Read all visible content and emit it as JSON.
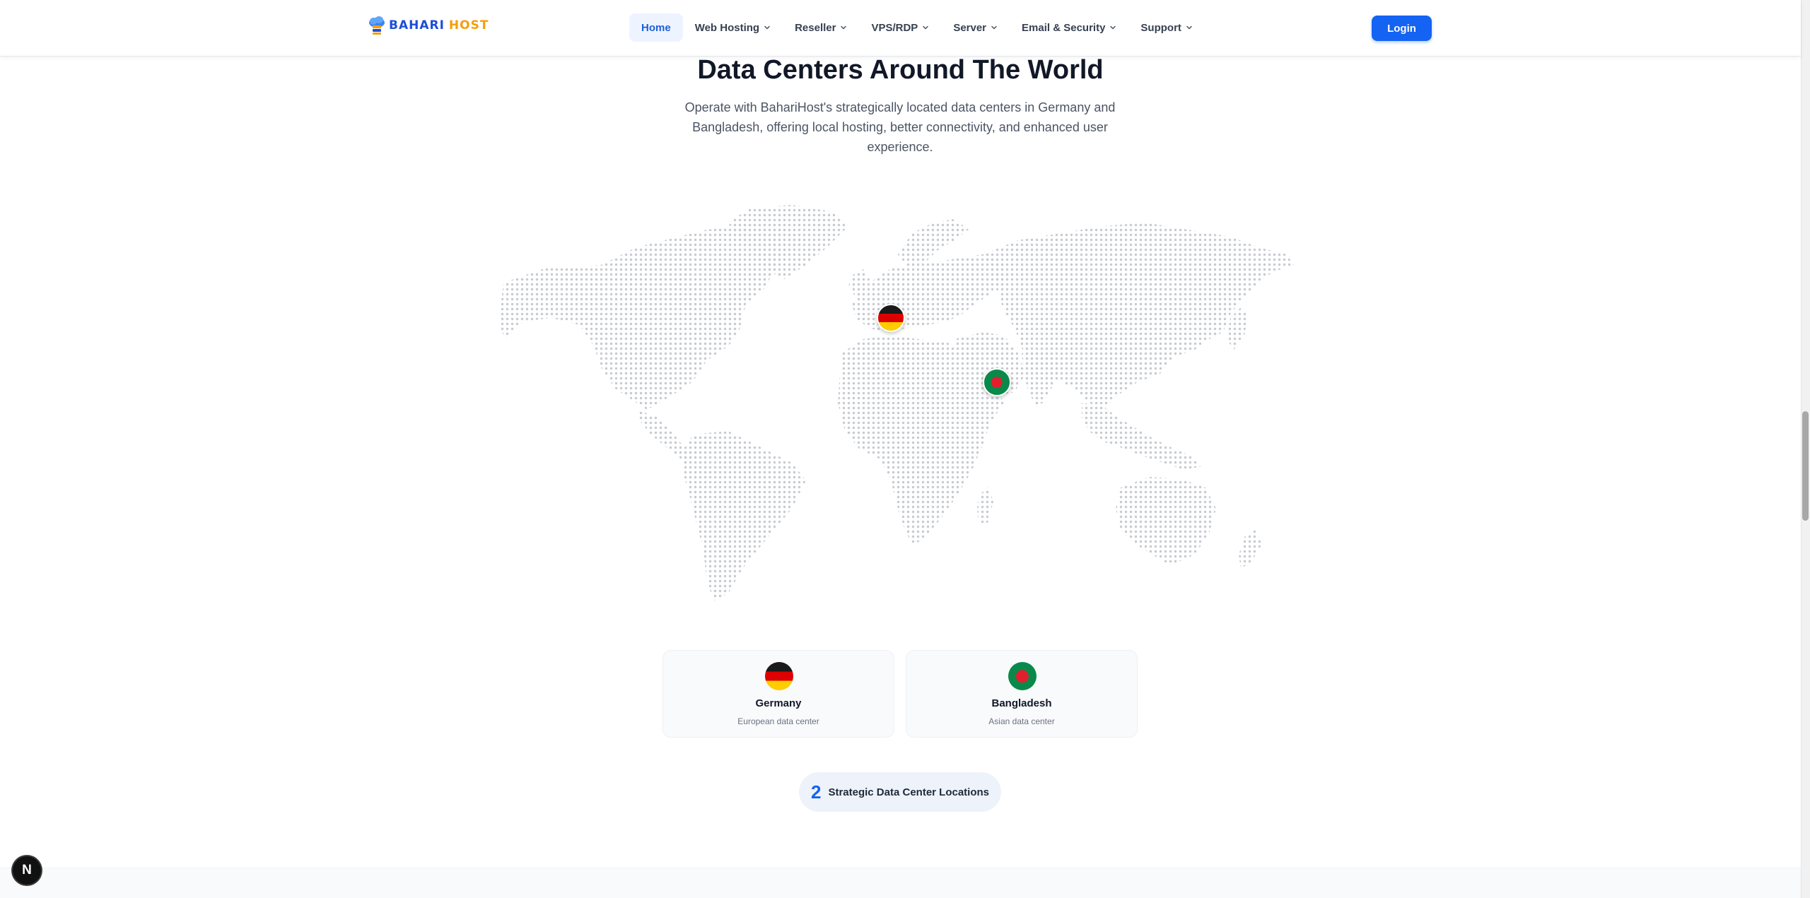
{
  "logo": {
    "brand_primary": "BAHARI",
    "brand_secondary": "HOST"
  },
  "nav": {
    "items": [
      {
        "label": "Home",
        "active": true,
        "dropdown": false
      },
      {
        "label": "Web Hosting",
        "active": false,
        "dropdown": true
      },
      {
        "label": "Reseller",
        "active": false,
        "dropdown": true
      },
      {
        "label": "VPS/RDP",
        "active": false,
        "dropdown": true
      },
      {
        "label": "Server",
        "active": false,
        "dropdown": true
      },
      {
        "label": "Email & Security",
        "active": false,
        "dropdown": true
      },
      {
        "label": "Support",
        "active": false,
        "dropdown": true
      }
    ],
    "login_label": "Login"
  },
  "section": {
    "title": "Data Centers Around The World",
    "subtitle": "Operate with BahariHost's strategically located data centers in Germany and Bangladesh, offering local hosting, better connectivity, and enhanced user experience."
  },
  "locations": [
    {
      "name": "Germany",
      "description": "European data center",
      "flag": "germany-flag-icon"
    },
    {
      "name": "Bangladesh",
      "description": "Asian data center",
      "flag": "bangladesh-flag-icon"
    }
  ],
  "stats": {
    "count": "2",
    "label": "Strategic Data Center Locations"
  },
  "floating_badge": {
    "letter": "N"
  },
  "colors": {
    "accent": "#1463f3",
    "title": "#111827",
    "map_dots": "#c7cad0",
    "card_bg": "#f8fafc",
    "pill_bg": "#eef3fb"
  }
}
